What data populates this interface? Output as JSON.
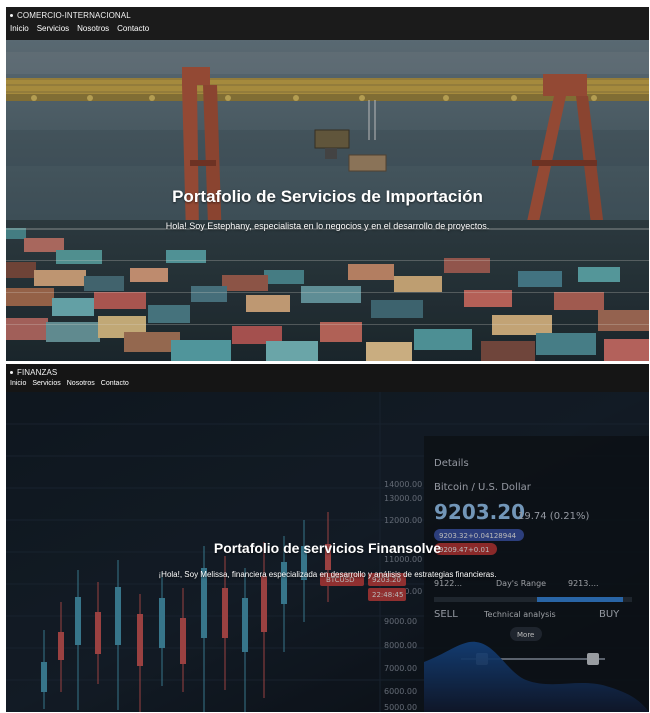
{
  "page": {
    "sections": [
      {
        "brand": "COMERCIO-INTERNACIONAL",
        "nav": [
          "Inicio",
          "Servicios",
          "Nosotros",
          "Contacto"
        ],
        "title": "Portafolio de Servicios de Importación",
        "subtitle": "Hola! Soy Estephany, especialista en lo negocios y en el desarrollo de proyectos."
      },
      {
        "brand": "FINANZAS",
        "nav": [
          "Inicio",
          "Servicios",
          "Nosotros",
          "Contacto"
        ],
        "title": "Portafolio de servicios Finansolve",
        "subtitle": "¡Hola!, Soy Melissa, financiera especializada en desarrollo y análisis de estrategias financieras.",
        "market": {
          "axis_labels": [
            "14000.00",
            "13000.00",
            "12000.00",
            "11000.00",
            "10000.00",
            "9000.00",
            "8000.00",
            "7000.00",
            "6000.00",
            "5000.00"
          ],
          "asset_title": "Bitcoin / U.S. Dollar",
          "price": "9203.20",
          "change": "19.74 (0.21%)",
          "quote_1": "9203.32+0.04128944",
          "quote_2": "9209.47+0.01",
          "ticker": "BTCUSD",
          "ticker_value": "9203.20",
          "timer": "22:48:45",
          "range_left": "9122...",
          "range_label": "Day's Range",
          "range_right": "9213....",
          "sell_label": "SELL",
          "technical_label": "Technical analysis",
          "buy_label": "BUY",
          "more_label": "More",
          "details_label": "Details"
        }
      }
    ]
  },
  "colors": {
    "dark_bar": "#1b1b1b",
    "crane_orange": "#a4523a",
    "crane_yellow": "#b89a45",
    "sea": "#43545d",
    "up_candle": "#4da2bf",
    "down_candle": "#d65a5a",
    "finance_blue": "#9fd0ff"
  },
  "icons": {
    "brand_mark": "dot-icon"
  }
}
